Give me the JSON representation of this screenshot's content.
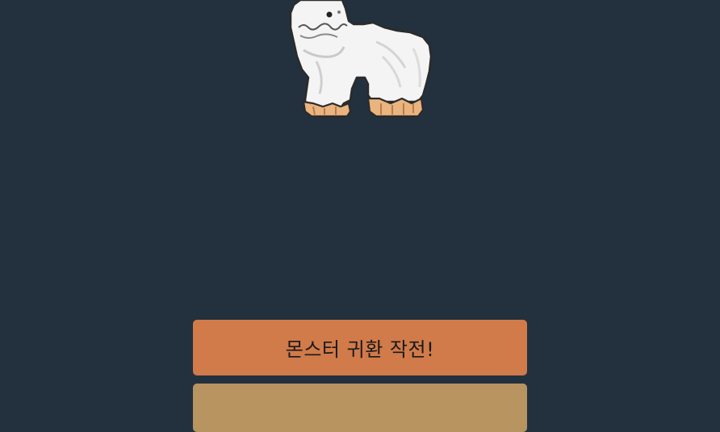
{
  "buttons": {
    "primary_label": "몬스터 귀환 작전!",
    "secondary_label": ""
  },
  "colors": {
    "background": "#22313d",
    "primary_button": "#d17a4a",
    "secondary_button": "#b89460",
    "monster_fur": "#f2f2f2",
    "monster_feet": "#eab47f"
  },
  "monster": {
    "icon": "yeti-monster-sprite"
  }
}
